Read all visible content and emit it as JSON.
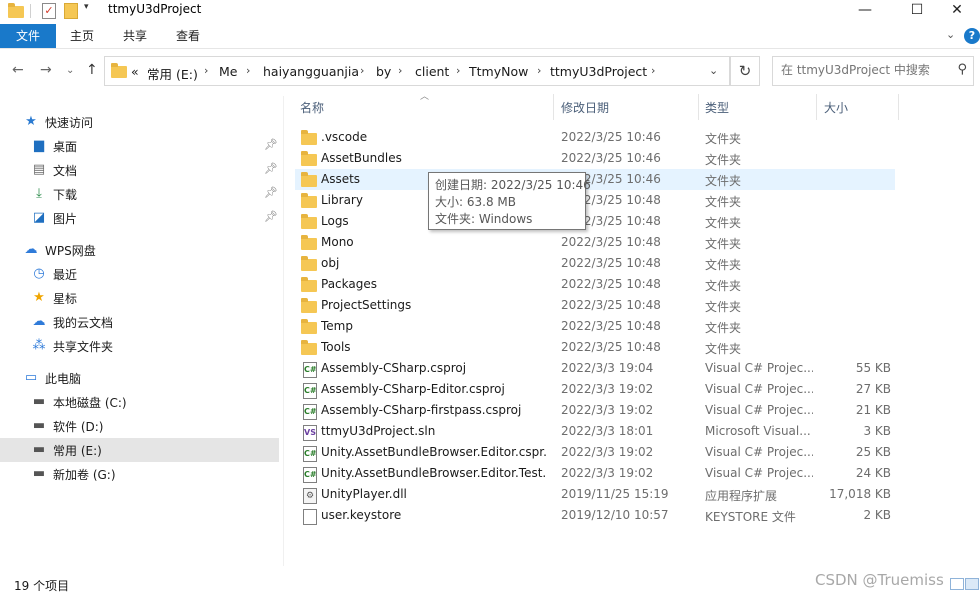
{
  "window": {
    "title": "ttmyU3dProject",
    "minimize": "—",
    "maximize": "☐",
    "close": "✕"
  },
  "ribbon": {
    "tabs": [
      "文件",
      "主页",
      "共享",
      "查看"
    ],
    "help": "?"
  },
  "address": {
    "overflow": "«",
    "crumbs": [
      "常用 (E:)",
      "Me",
      "haiyangguanjia",
      "by",
      "client",
      "TtmyNow",
      "ttmyU3dProject"
    ]
  },
  "search": {
    "placeholder": "在 ttmyU3dProject 中搜索"
  },
  "sidebar": {
    "items": [
      {
        "label": "快速访问",
        "icon": "star-icon"
      },
      {
        "label": "桌面",
        "icon": "desktop-icon",
        "pinned": true
      },
      {
        "label": "文档",
        "icon": "documents-icon",
        "pinned": true
      },
      {
        "label": "下载",
        "icon": "download-icon",
        "pinned": true
      },
      {
        "label": "图片",
        "icon": "pictures-icon",
        "pinned": true
      },
      {
        "label": "WPS网盘",
        "icon": "cloud-icon"
      },
      {
        "label": "最近",
        "icon": "clock-icon"
      },
      {
        "label": "星标",
        "icon": "star-icon"
      },
      {
        "label": "我的云文档",
        "icon": "cloud-icon"
      },
      {
        "label": "共享文件夹",
        "icon": "share-icon"
      },
      {
        "label": "此电脑",
        "icon": "computer-icon"
      },
      {
        "label": "本地磁盘 (C:)",
        "icon": "drive-icon"
      },
      {
        "label": "软件 (D:)",
        "icon": "drive-icon"
      },
      {
        "label": "常用 (E:)",
        "icon": "drive-icon",
        "selected": true
      },
      {
        "label": "新加卷 (G:)",
        "icon": "drive-icon"
      }
    ]
  },
  "columns": {
    "name": "名称",
    "date": "修改日期",
    "type": "类型",
    "size": "大小"
  },
  "files": [
    {
      "name": ".vscode",
      "date": "2022/3/25 10:46",
      "type": "文件夹",
      "size": "",
      "kind": "folder"
    },
    {
      "name": "AssetBundles",
      "date": "2022/3/25 10:46",
      "type": "文件夹",
      "size": "",
      "kind": "folder"
    },
    {
      "name": "Assets",
      "date": "2022/3/25 10:46",
      "type": "文件夹",
      "size": "",
      "kind": "folder"
    },
    {
      "name": "Library",
      "date": "2022/3/25 10:48",
      "type": "文件夹",
      "size": "",
      "kind": "folder"
    },
    {
      "name": "Logs",
      "date": "2022/3/25 10:48",
      "type": "文件夹",
      "size": "",
      "kind": "folder"
    },
    {
      "name": "Mono",
      "date": "2022/3/25 10:48",
      "type": "文件夹",
      "size": "",
      "kind": "folder"
    },
    {
      "name": "obj",
      "date": "2022/3/25 10:48",
      "type": "文件夹",
      "size": "",
      "kind": "folder"
    },
    {
      "name": "Packages",
      "date": "2022/3/25 10:48",
      "type": "文件夹",
      "size": "",
      "kind": "folder"
    },
    {
      "name": "ProjectSettings",
      "date": "2022/3/25 10:48",
      "type": "文件夹",
      "size": "",
      "kind": "folder"
    },
    {
      "name": "Temp",
      "date": "2022/3/25 10:48",
      "type": "文件夹",
      "size": "",
      "kind": "folder"
    },
    {
      "name": "Tools",
      "date": "2022/3/25 10:48",
      "type": "文件夹",
      "size": "",
      "kind": "folder"
    },
    {
      "name": "Assembly-CSharp.csproj",
      "date": "2022/3/3 19:04",
      "type": "Visual C# Projec...",
      "size": "55 KB",
      "kind": "doc"
    },
    {
      "name": "Assembly-CSharp-Editor.csproj",
      "date": "2022/3/3 19:02",
      "type": "Visual C# Projec...",
      "size": "27 KB",
      "kind": "doc"
    },
    {
      "name": "Assembly-CSharp-firstpass.csproj",
      "date": "2022/3/3 19:02",
      "type": "Visual C# Projec...",
      "size": "21 KB",
      "kind": "doc"
    },
    {
      "name": "ttmyU3dProject.sln",
      "date": "2022/3/3 18:01",
      "type": "Microsoft Visual...",
      "size": "3 KB",
      "kind": "sln"
    },
    {
      "name": "Unity.AssetBundleBrowser.Editor.cspr...",
      "date": "2022/3/3 19:02",
      "type": "Visual C# Projec...",
      "size": "25 KB",
      "kind": "doc"
    },
    {
      "name": "Unity.AssetBundleBrowser.Editor.Test...",
      "date": "2022/3/3 19:02",
      "type": "Visual C# Projec...",
      "size": "24 KB",
      "kind": "doc"
    },
    {
      "name": "UnityPlayer.dll",
      "date": "2019/11/25 15:19",
      "type": "应用程序扩展",
      "size": "17,018 KB",
      "kind": "dll"
    },
    {
      "name": "user.keystore",
      "date": "2019/12/10 10:57",
      "type": "KEYSTORE 文件",
      "size": "2 KB",
      "kind": "plain"
    }
  ],
  "tooltip": {
    "created": "创建日期: 2022/3/25 10:46",
    "size": "大小: 63.8 MB",
    "folders": "文件夹: Windows"
  },
  "status": {
    "count": "19 个项目"
  },
  "watermark": "CSDN @Truemiss",
  "colors": {
    "accent": "#1979ca",
    "hover": "#e5f3ff",
    "selected": "#e5e5e5",
    "folder": "#f5c754"
  }
}
